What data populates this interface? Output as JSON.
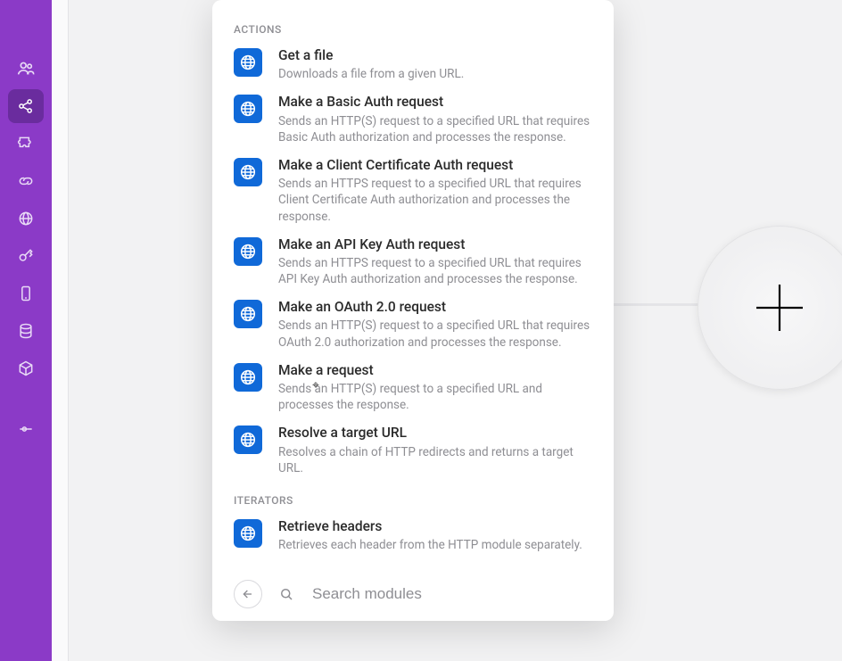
{
  "sidebar": {
    "items": [
      {
        "name": "users-icon"
      },
      {
        "name": "share-icon",
        "active": true
      },
      {
        "name": "puzzle-icon"
      },
      {
        "name": "link-icon"
      },
      {
        "name": "globe-icon"
      },
      {
        "name": "key-icon"
      },
      {
        "name": "mobile-icon"
      },
      {
        "name": "database-icon"
      },
      {
        "name": "cube-icon"
      },
      {
        "name": "settings-slider-icon"
      }
    ]
  },
  "panel": {
    "sections": [
      {
        "label": "ACTIONS",
        "items": [
          {
            "title": "Get a file",
            "desc": "Downloads a file from a given URL."
          },
          {
            "title": "Make a Basic Auth request",
            "desc": "Sends an HTTP(S) request to a specified URL that requires Basic Auth authorization and processes the response."
          },
          {
            "title": "Make a Client Certificate Auth request",
            "desc": "Sends an HTTPS request to a specified URL that requires Client Certificate Auth authorization and processes the response."
          },
          {
            "title": "Make an API Key Auth request",
            "desc": "Sends an HTTPS request to a specified URL that requires API Key Auth authorization and processes the response."
          },
          {
            "title": "Make an OAuth 2.0 request",
            "desc": "Sends an HTTP(S) request to a specified URL that requires OAuth 2.0 authorization and processes the response."
          },
          {
            "title": "Make a request",
            "desc": "Sends an HTTP(S) request to a specified URL and processes the response."
          },
          {
            "title": "Resolve a target URL",
            "desc": "Resolves a chain of HTTP redirects and returns a target URL."
          }
        ]
      },
      {
        "label": "ITERATORS",
        "items": [
          {
            "title": "Retrieve headers",
            "desc": "Retrieves each header from the HTTP module separately."
          }
        ]
      }
    ],
    "search_placeholder": "Search modules"
  },
  "colors": {
    "sidebar": "#8b3ac7",
    "module_icon": "#1069d8"
  }
}
